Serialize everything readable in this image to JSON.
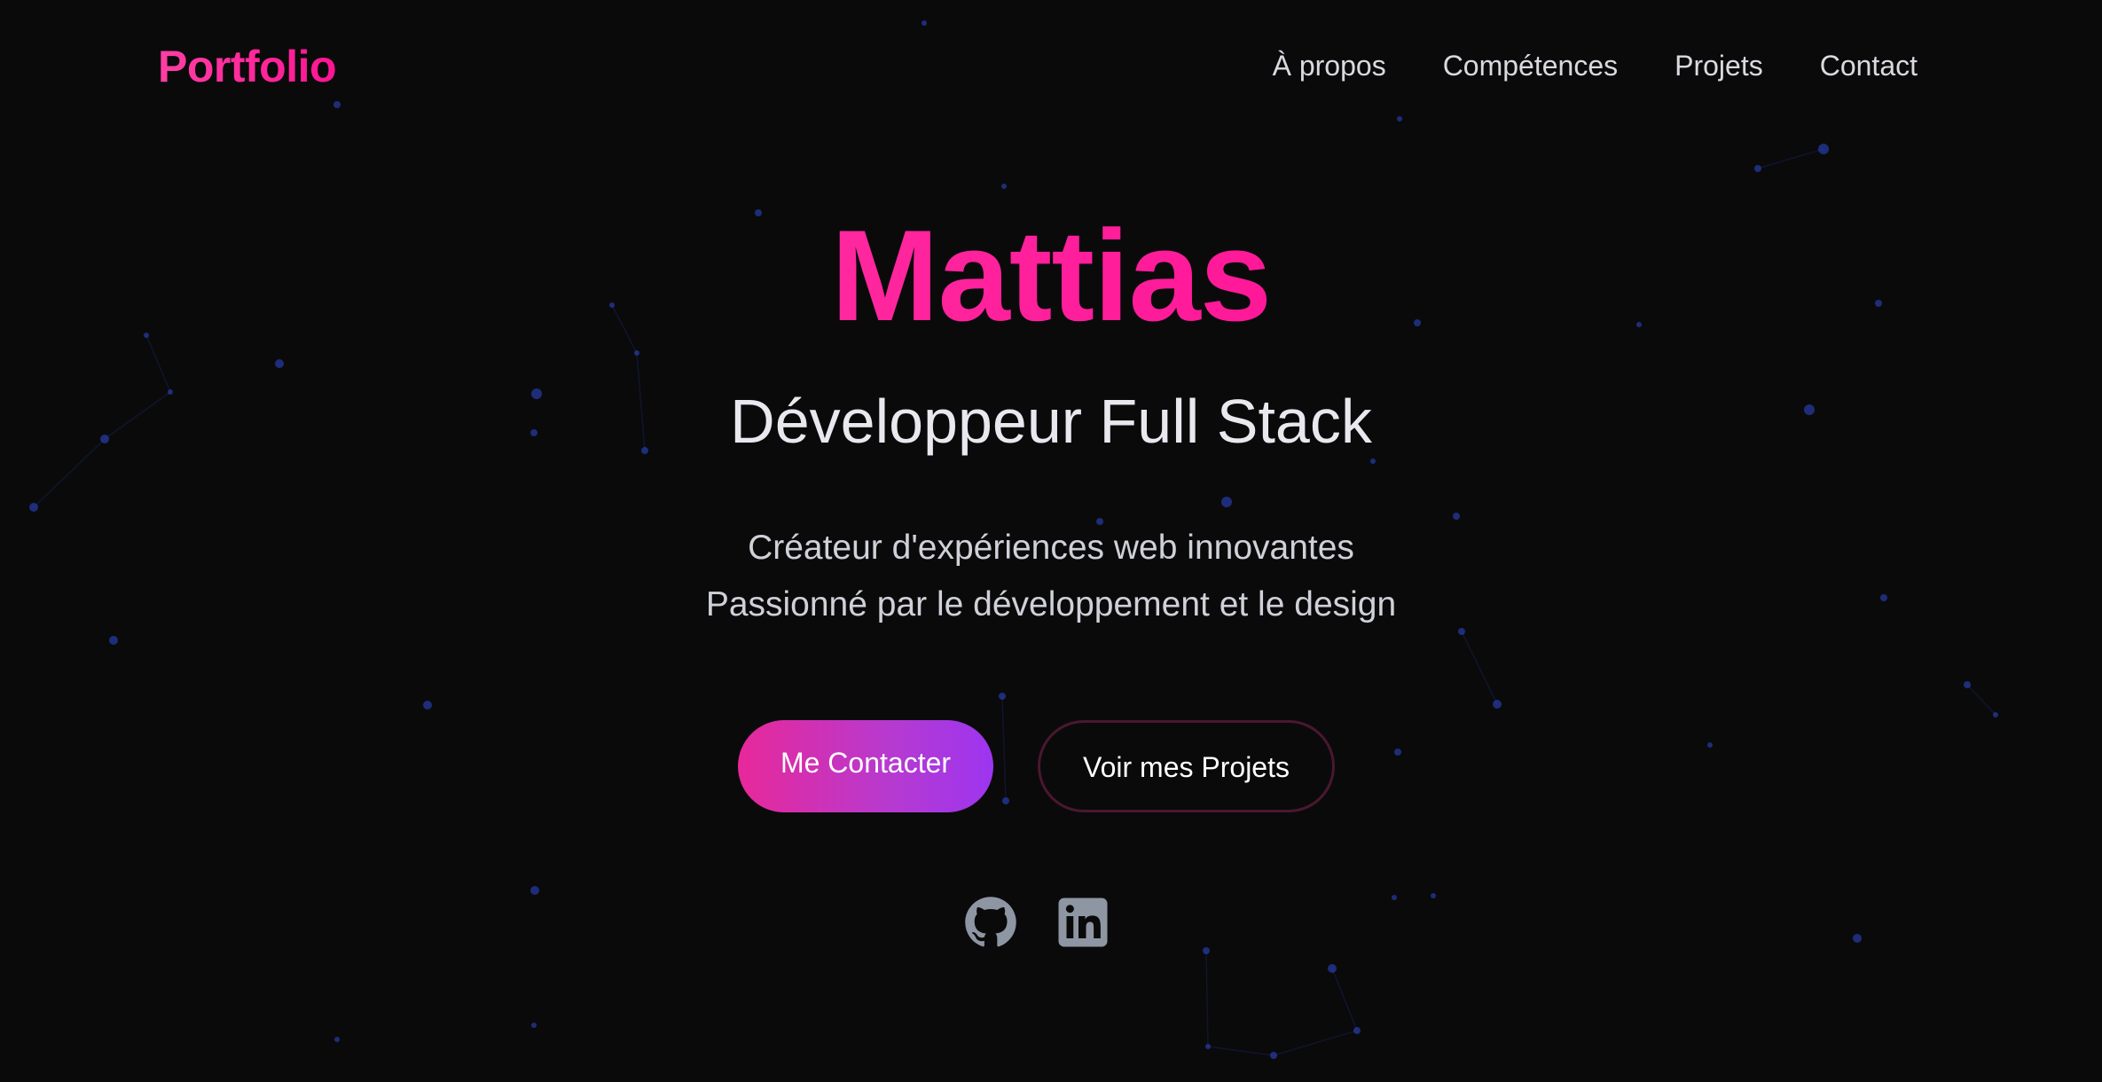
{
  "nav": {
    "logo": "Portfolio",
    "links": [
      "À propos",
      "Compétences",
      "Projets",
      "Contact"
    ]
  },
  "hero": {
    "name": "Mattias",
    "role": "Développeur Full Stack",
    "tagline_1": "Créateur d'expériences web innovantes",
    "tagline_2": "Passionné par le développement et le design"
  },
  "buttons": {
    "contact_label": "Me Contacter",
    "projects_label": "Voir mes Projets"
  },
  "social": {
    "icons": [
      "github-icon",
      "linkedin-icon"
    ]
  },
  "colors": {
    "background": "#0a0a0b",
    "accent_pink": "#ff1f9b",
    "accent_purple": "#9d35f0",
    "particle": "#2f4bd6",
    "icon_gray": "#8e96a3"
  }
}
